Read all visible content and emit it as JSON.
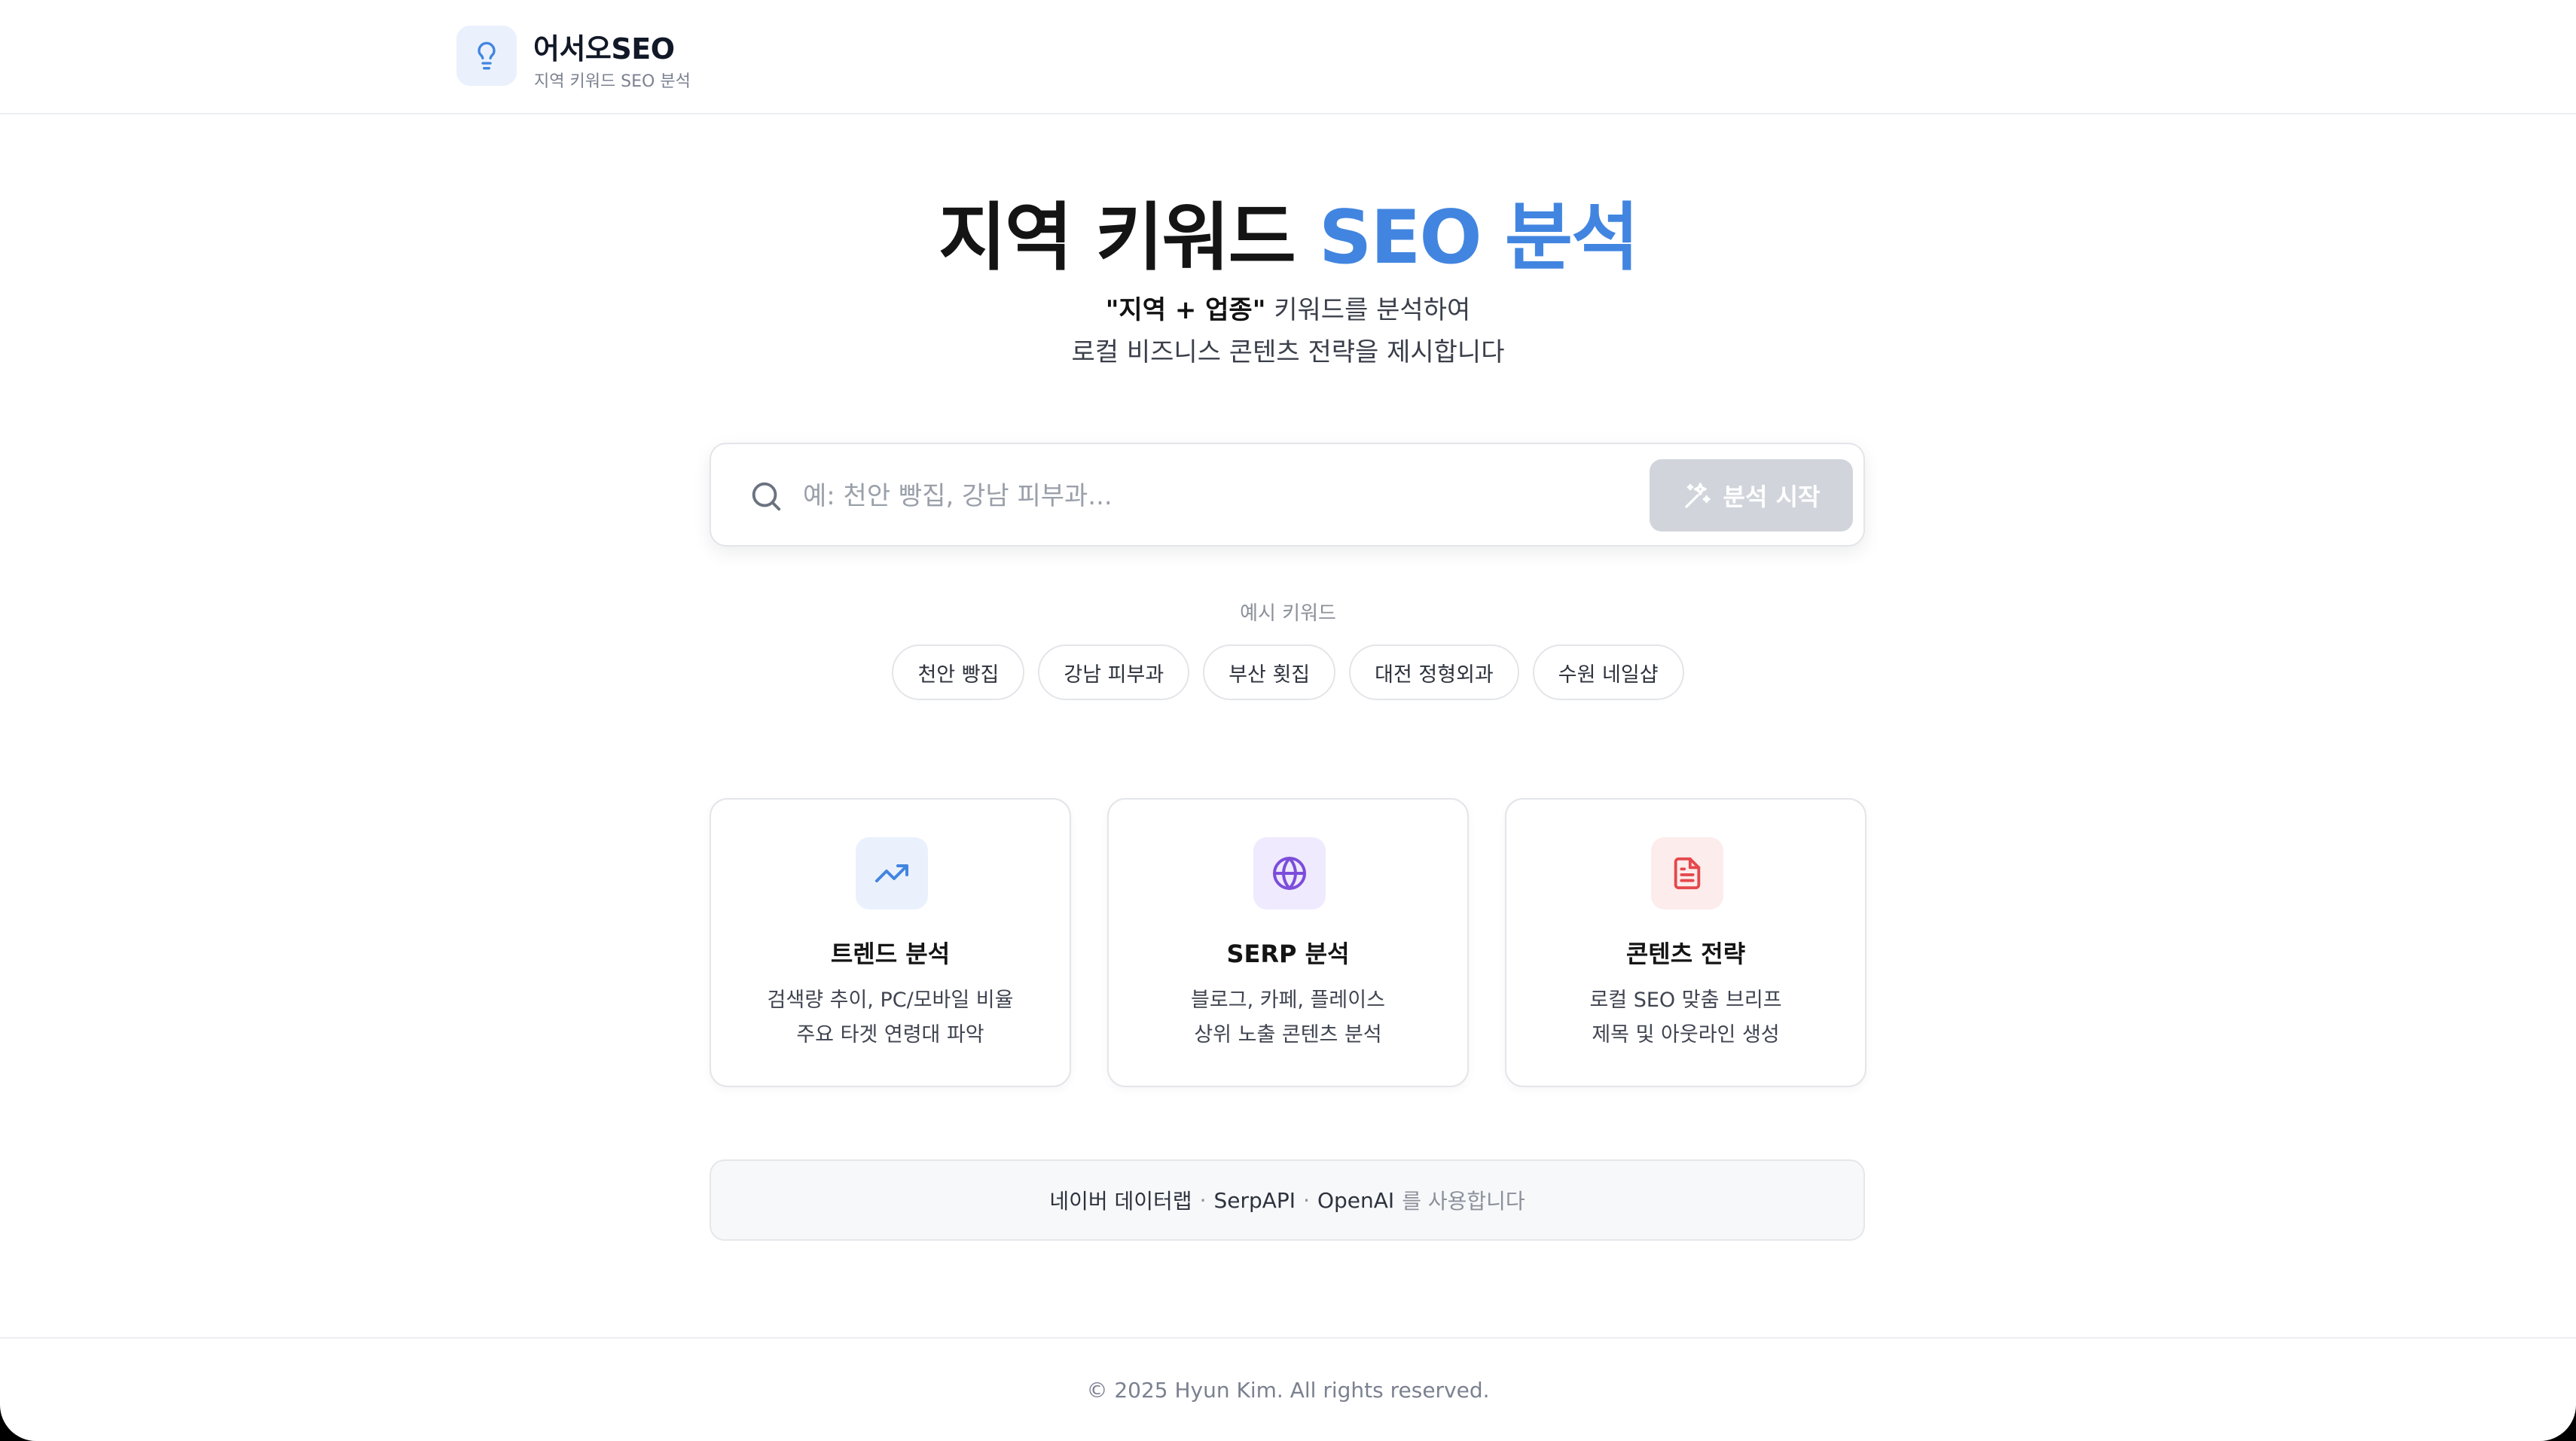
{
  "header": {
    "brand_name": "어서오SEO",
    "brand_subtitle": "지역 키워드 SEO 분석",
    "logo_icon": "lightbulb-icon"
  },
  "hero": {
    "title_main": "지역 키워드 ",
    "title_accent": "SEO 분석",
    "subtitle_bold": "\"지역 + 업종\"",
    "subtitle_rest": " 키워드를 분석하여",
    "subtitle_line2": "로컬 비즈니스 콘텐츠 전략을 제시합니다",
    "accent_color": "#4285e0"
  },
  "search": {
    "placeholder": "예: 천안 빵집, 강남 피부과...",
    "value": "",
    "button_label": "분석 시작",
    "button_icon": "sparkles-icon",
    "button_state": "disabled"
  },
  "examples": {
    "label": "예시 키워드",
    "chips": [
      "천안 빵집",
      "강남 피부과",
      "부산 횟집",
      "대전 정형외과",
      "수원 네일샵"
    ]
  },
  "features": [
    {
      "icon": "trending-up-icon",
      "title": "트렌드 분석",
      "line1": "검색량 추이, PC/모바일 비율",
      "line2": "주요 타겟 연령대 파악",
      "color": "#4285e0",
      "bg": "#eaf1fd"
    },
    {
      "icon": "globe-icon",
      "title": "SERP 분석",
      "line1": "블로그, 카페, 플레이스",
      "line2": "상위 노출 콘텐츠 분석",
      "color": "#7c4ddb",
      "bg": "#efeafd"
    },
    {
      "icon": "document-icon",
      "title": "콘텐츠 전략",
      "line1": "로컬 SEO 맞춤 브리프",
      "line2": "제목 및 아웃라인 생성",
      "color": "#e5484d",
      "bg": "#fdecec"
    }
  ],
  "info": {
    "source1": "네이버 데이터랩",
    "sep": "·",
    "source2": "SerpAPI",
    "source3": "OpenAI",
    "suffix": "를 사용합니다"
  },
  "footer": {
    "copyright": "© 2025 Hyun Kim. All rights reserved."
  }
}
